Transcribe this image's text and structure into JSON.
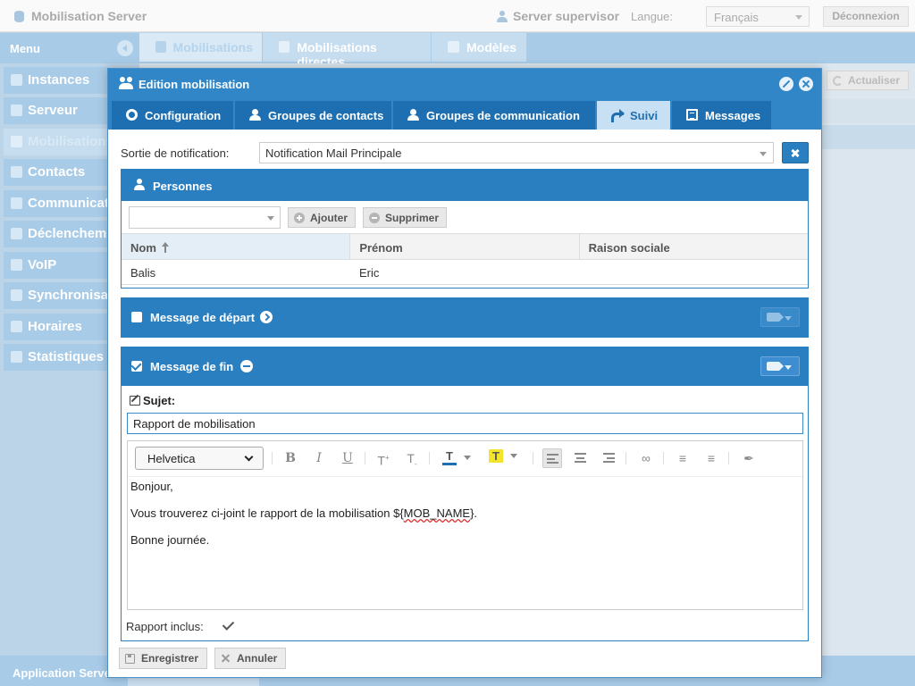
{
  "app": {
    "title": "Mobilisation Server",
    "user": "Server supervisor",
    "language_label": "Langue:",
    "language_value": "Français",
    "logout_label": "Déconnexion"
  },
  "menu": {
    "title": "Menu",
    "items": [
      {
        "label": "Instances",
        "icon": "bell-icon"
      },
      {
        "label": "Serveur",
        "icon": "gear-icon"
      },
      {
        "label": "Mobilisations",
        "icon": "users-icon"
      },
      {
        "label": "Contacts",
        "icon": "address-book-icon"
      },
      {
        "label": "Communications",
        "icon": "exchange-icon"
      },
      {
        "label": "Déclenchements",
        "icon": "play-icon"
      },
      {
        "label": "VoIP",
        "icon": "phone-icon"
      },
      {
        "label": "Synchronisation",
        "icon": "database-icon"
      },
      {
        "label": "Horaires",
        "icon": "clock-icon"
      },
      {
        "label": "Statistiques",
        "icon": "chart-icon"
      }
    ],
    "active_index": 2
  },
  "main_tabs": [
    {
      "label": "Mobilisations",
      "icon": "users-icon"
    },
    {
      "label": "Mobilisations directes",
      "icon": "crosshair-icon"
    },
    {
      "label": "Modèles",
      "icon": "file-icon"
    }
  ],
  "refresh_label": "Actualiser",
  "statusbar": {
    "label": "Application Server"
  },
  "modal": {
    "title": "Edition mobilisation",
    "tabs": [
      {
        "label": "Configuration",
        "icon": "gear-icon"
      },
      {
        "label": "Groupes de contacts",
        "icon": "user-icon"
      },
      {
        "label": "Groupes de communication",
        "icon": "user-icon"
      },
      {
        "label": "Suivi",
        "icon": "share-icon"
      },
      {
        "label": "Messages",
        "icon": "list-icon"
      }
    ],
    "active_tab": 3,
    "notification_label": "Sortie de notification:",
    "notification_value": "Notification Mail Principale",
    "persons": {
      "title": "Personnes",
      "add_label": "Ajouter",
      "remove_label": "Supprimer",
      "columns": [
        "Nom",
        "Prénom",
        "Raison sociale"
      ],
      "rows": [
        [
          "Balis",
          "Eric",
          ""
        ]
      ]
    },
    "start_message": {
      "label": "Message de départ",
      "checked": false
    },
    "end_message": {
      "label": "Message de fin",
      "checked": true,
      "subject_label": "Sujet:",
      "subject_value": "Rapport de mobilisation",
      "font": "Helvetica",
      "body": {
        "line1": "Bonjour,",
        "line2_prefix": "Vous trouverez ci-joint le rapport de la mobilisation ${",
        "line2_var": "MOB_NAME",
        "line2_suffix": "}.",
        "line3": "Bonne journée."
      },
      "report_label": "Rapport inclus:",
      "report_included": true
    },
    "save_label": "Enregistrer",
    "cancel_label": "Annuler"
  },
  "colors": {
    "header_blue": "#3186c7",
    "panel_blue": "#2a7fc1",
    "menu_blue": "#a8cbe8",
    "highlight_yellow": "#f2e42b"
  }
}
